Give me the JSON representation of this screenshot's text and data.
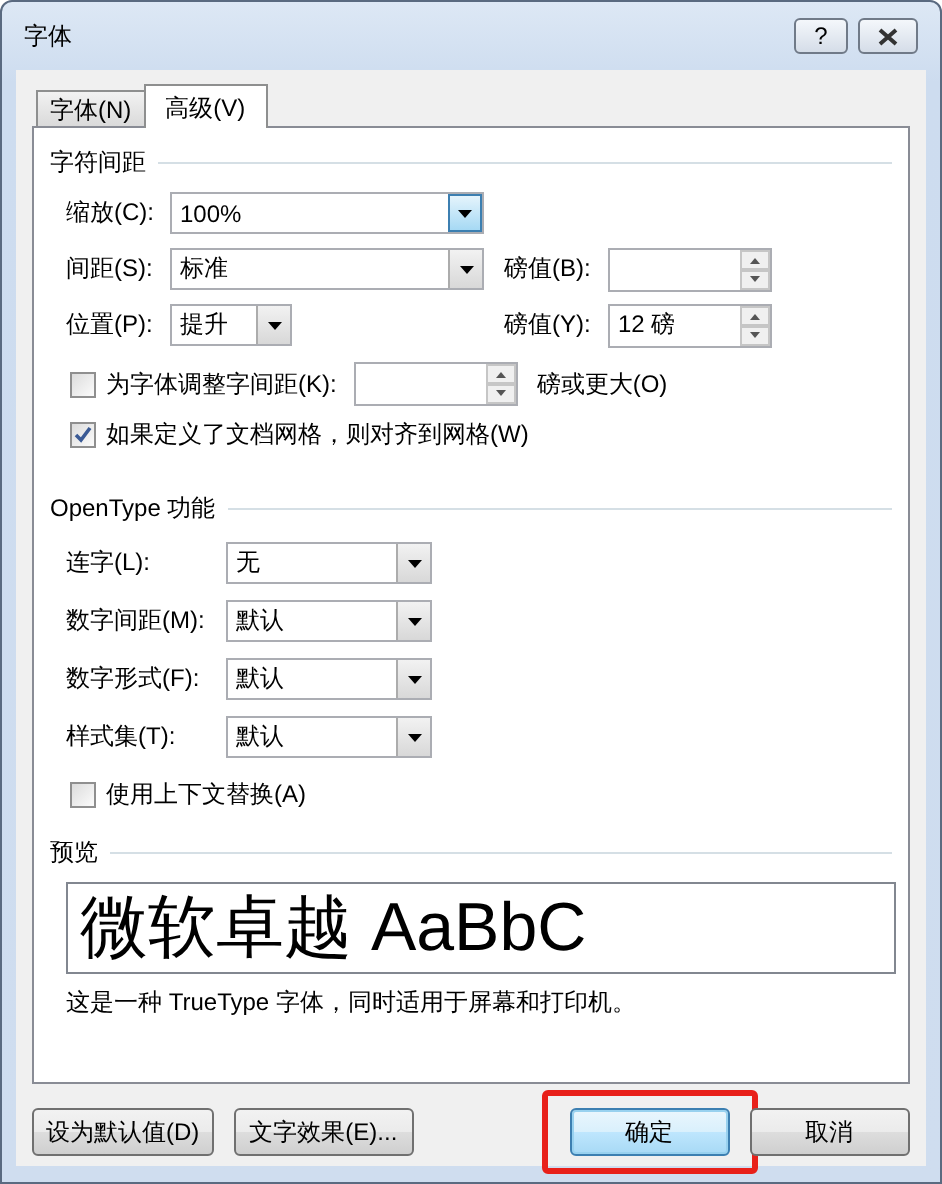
{
  "window": {
    "title": "字体",
    "help": "?"
  },
  "tabs": [
    {
      "label": "字体(N)",
      "selected": false
    },
    {
      "label": "高级(V)",
      "selected": true
    }
  ],
  "character_spacing": {
    "title": "字符间距",
    "scale": {
      "label": "缩放(C):",
      "value": "100%",
      "focused": true
    },
    "spacing": {
      "label": "间距(S):",
      "value": "标准",
      "focused": false
    },
    "spacing_by": {
      "label": "磅值(B):"
    },
    "position": {
      "label": "位置(P):",
      "value": "提升",
      "focused": false
    },
    "position_by": {
      "label": "磅值(Y):",
      "value": "12 磅"
    },
    "kerning": {
      "label": "为字体调整字间距(K):",
      "checked": false,
      "suffix": "磅或更大(O)"
    },
    "snap_to_grid": {
      "label": "如果定义了文档网格，则对齐到网格(W)",
      "checked": true
    }
  },
  "opentype": {
    "title": "OpenType 功能",
    "fields": [
      {
        "label": "连字(L):",
        "value": "无"
      },
      {
        "label": "数字间距(M):",
        "value": "默认"
      },
      {
        "label": "数字形式(F):",
        "value": "默认"
      },
      {
        "label": "样式集(T):",
        "value": "默认"
      }
    ],
    "contextual": {
      "label": "使用上下文替换(A)",
      "checked": false
    }
  },
  "preview": {
    "title": "预览",
    "sample": "微软卓越 AaBbC",
    "description": "这是一种 TrueType 字体，同时适用于屏幕和打印机。"
  },
  "buttons": [
    {
      "label": "设为默认值(D)",
      "default": false,
      "highlighted": false
    },
    {
      "label": "文字效果(E)...",
      "default": false,
      "highlighted": false
    },
    {
      "label": "确定",
      "default": true,
      "highlighted": true
    },
    {
      "label": "取消",
      "default": false,
      "highlighted": false
    }
  ]
}
